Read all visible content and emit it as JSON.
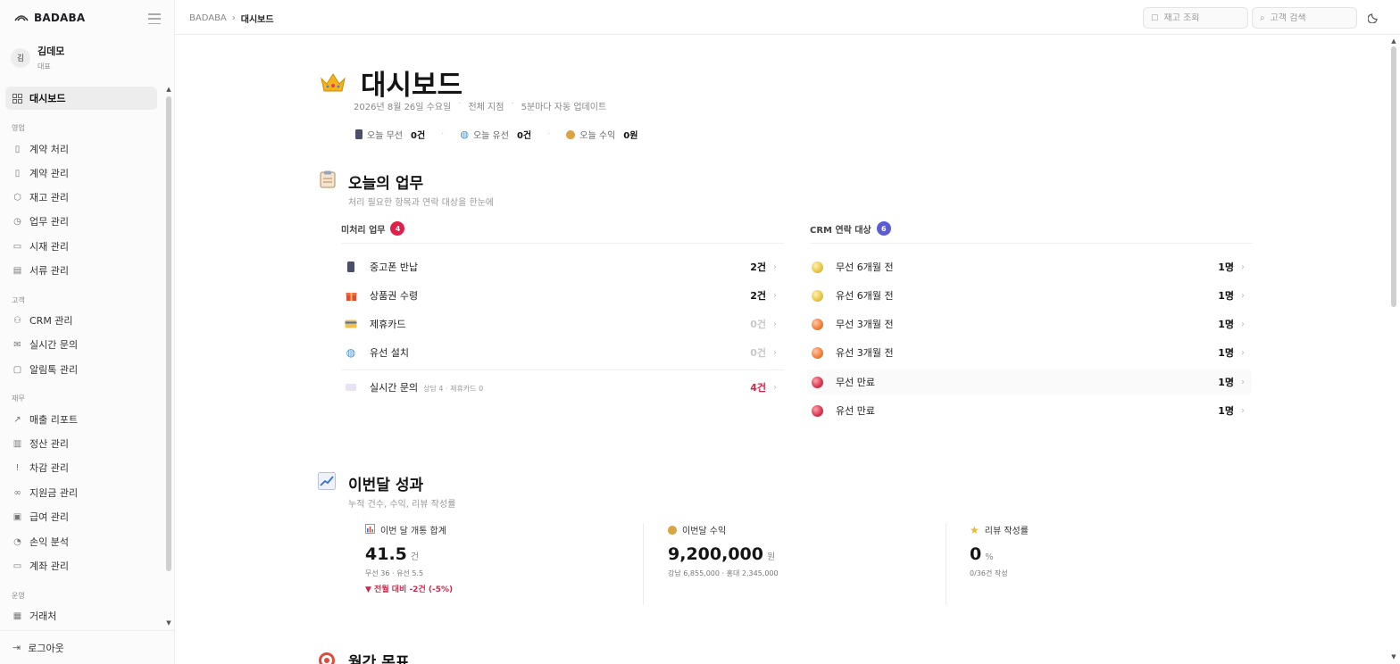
{
  "brand": {
    "name": "BADABA"
  },
  "user": {
    "avatar": "김",
    "name": "김데모",
    "role": "대표"
  },
  "sidebar": {
    "active": "대시보드",
    "sections": {
      "sales": "영업",
      "customer": "고객",
      "finance": "재무",
      "ops": "운영"
    },
    "items": [
      {
        "label": "대시보드",
        "icon": "grid-icon"
      },
      {
        "label": "계약 처리",
        "icon": "file-plus-icon"
      },
      {
        "label": "계약 관리",
        "icon": "phone-icon"
      },
      {
        "label": "재고 관리",
        "icon": "box-icon"
      },
      {
        "label": "업무 관리",
        "icon": "clock-icon"
      },
      {
        "label": "시재 관리",
        "icon": "cash-icon"
      },
      {
        "label": "서류 관리",
        "icon": "document-icon"
      },
      {
        "label": "CRM 관리",
        "icon": "users-icon"
      },
      {
        "label": "실시간 문의",
        "icon": "inbox-icon"
      },
      {
        "label": "알림톡 관리",
        "icon": "message-icon"
      },
      {
        "label": "매출 리포트",
        "icon": "trend-icon"
      },
      {
        "label": "정산 관리",
        "icon": "bar-chart-icon"
      },
      {
        "label": "차감 관리",
        "icon": "alert-icon"
      },
      {
        "label": "지원금 관리",
        "icon": "link-icon"
      },
      {
        "label": "급여 관리",
        "icon": "wallet-icon"
      },
      {
        "label": "손익 분석",
        "icon": "pie-icon"
      },
      {
        "label": "계좌 관리",
        "icon": "bank-icon"
      },
      {
        "label": "거래처",
        "icon": "building-icon"
      }
    ],
    "logout": "로그아웃"
  },
  "topbar": {
    "breadcrumb": [
      "BADABA",
      "대시보드"
    ],
    "inventory_placeholder": "재고 조회",
    "customer_placeholder": "고객 검색"
  },
  "header": {
    "title": "대시보드",
    "date": "2026년 8월 26일 수요일",
    "scope": "전체 지점",
    "refresh": "5분마다 자동 업데이트",
    "stats": [
      {
        "label": "오늘 무선",
        "value": "0건",
        "icon": "phone-icon"
      },
      {
        "label": "오늘 유선",
        "value": "0건",
        "icon": "globe-icon"
      },
      {
        "label": "오늘 수익",
        "value": "0원",
        "icon": "money-bag-icon"
      }
    ]
  },
  "today": {
    "title": "오늘의 업무",
    "subtitle": "처리 필요한 항목과 연락 대상을 한눈에",
    "pending": {
      "title": "미처리 업무",
      "count": "4",
      "items": [
        {
          "label": "중고폰 반납",
          "value": "2건",
          "icon": "phone-icon"
        },
        {
          "label": "상품권 수령",
          "value": "2건",
          "icon": "gift-icon"
        },
        {
          "label": "제휴카드",
          "value": "0건",
          "icon": "card-icon"
        },
        {
          "label": "유선 설치",
          "value": "0건",
          "icon": "globe-icon"
        },
        {
          "label": "실시간 문의",
          "sub": "상담 4 · 제휴카드 0",
          "value": "4건",
          "icon": "chat-icon"
        }
      ]
    },
    "crm": {
      "title": "CRM 연락 대상",
      "count": "6",
      "items": [
        {
          "label": "무선 6개월 전",
          "value": "1명",
          "color": "#e8c442"
        },
        {
          "label": "유선 6개월 전",
          "value": "1명",
          "color": "#e8c442"
        },
        {
          "label": "무선 3개월 전",
          "value": "1명",
          "color": "#ef7d3b"
        },
        {
          "label": "유선 3개월 전",
          "value": "1명",
          "color": "#ef7d3b"
        },
        {
          "label": "무선 만료",
          "value": "1명",
          "color": "#d8344a"
        },
        {
          "label": "유선 만료",
          "value": "1명",
          "color": "#d8344a"
        }
      ]
    }
  },
  "month": {
    "title": "이번달 성과",
    "subtitle": "누적 건수, 수익, 리뷰 작성률",
    "kpis": [
      {
        "label": "이번 달 개통 합계",
        "value": "41.5",
        "unit": "건",
        "detail": "무선 36 · 유선 5.5",
        "delta": "▼ 전월 대비 -2건 (-5%)",
        "icon": "bar-chart-icon"
      },
      {
        "label": "이번달 수익",
        "value": "9,200,000",
        "unit": "원",
        "detail": "강남 6,855,000 · 홍대 2,345,000",
        "delta": "",
        "icon": "money-bag-icon"
      },
      {
        "label": "리뷰 작성률",
        "value": "0",
        "unit": "%",
        "detail": "0/36건 작성",
        "delta": "",
        "icon": "star-icon"
      }
    ]
  },
  "goal": {
    "title": "월간 목표"
  },
  "colors": {
    "accent_red": "#e11d48",
    "accent_indigo": "#5b5bd6",
    "crm_yellow": "#e8c442",
    "crm_orange": "#ef7d3b",
    "crm_red": "#d8344a"
  }
}
